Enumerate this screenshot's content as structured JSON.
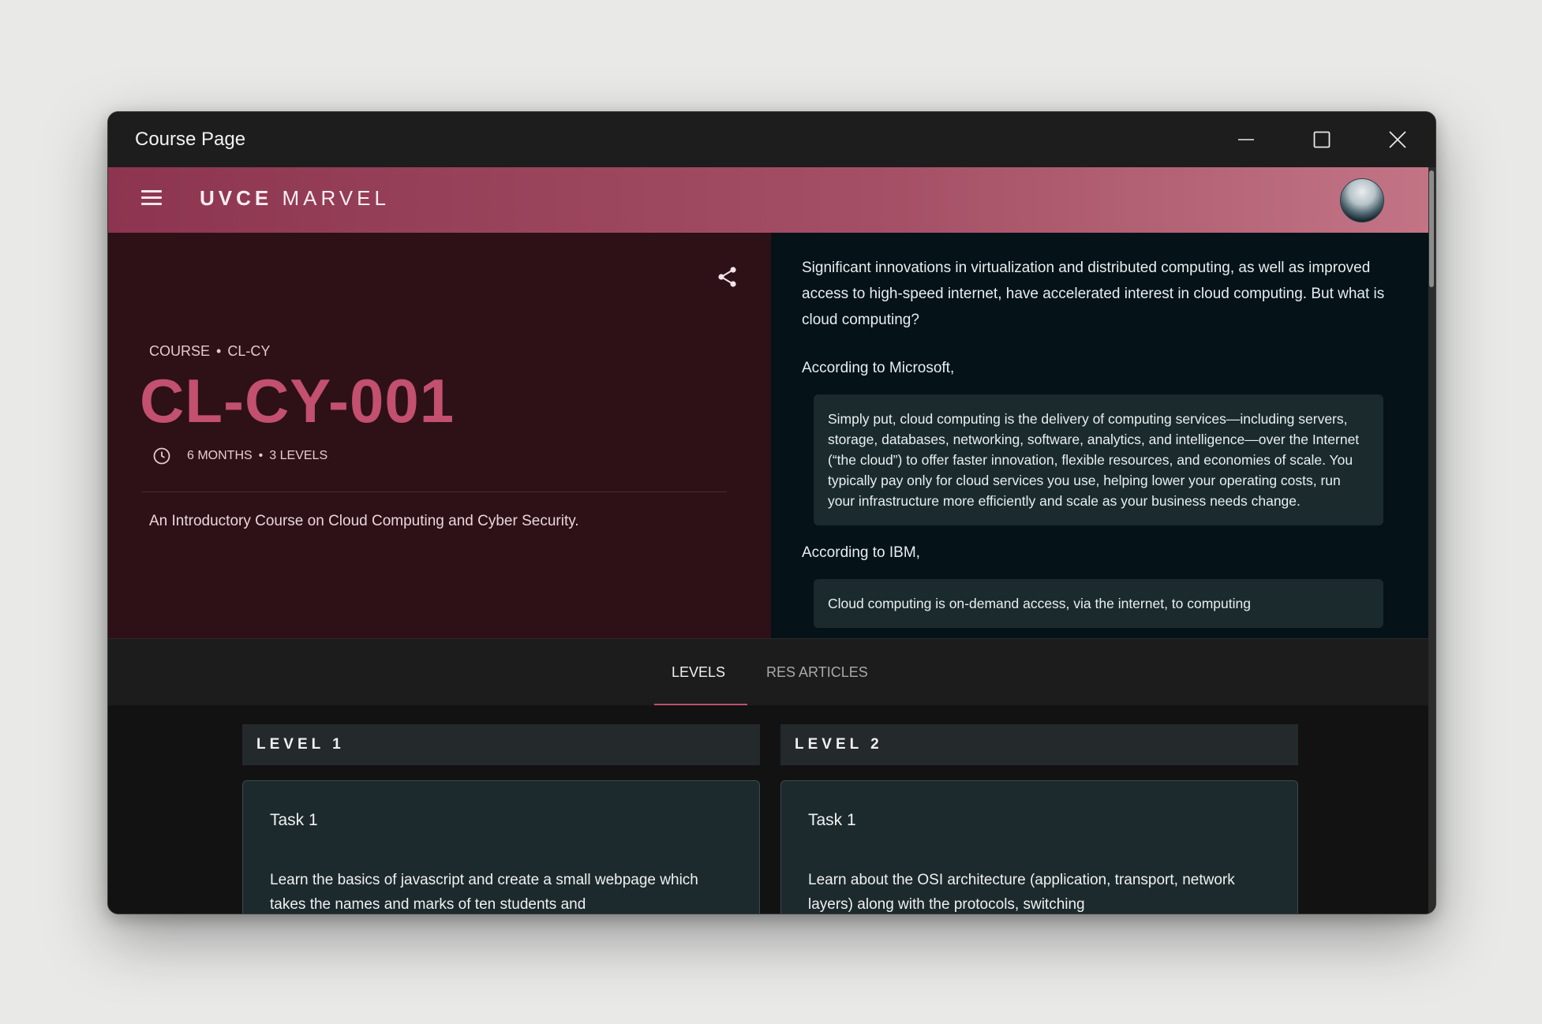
{
  "window": {
    "title": "Course Page"
  },
  "appbar": {
    "brand_bold": "UVCE",
    "brand_light": "MARVEL",
    "menu_icon": "hamburger-icon",
    "avatar_icon": "avatar"
  },
  "course": {
    "type_label": "COURSE",
    "category": "CL-CY",
    "code": "CL-CY-001",
    "duration": "6 MONTHS",
    "levels_count": "3 LEVELS",
    "description": "An Introductory Course on Cloud Computing and Cyber Security.",
    "share_icon": "share-icon",
    "clock_icon": "clock-icon"
  },
  "article": {
    "intro": "Significant innovations in virtualization and distributed computing, as well as improved access to high-speed internet, have accelerated interest in cloud computing. But what is cloud computing?",
    "according_microsoft": "According to Microsoft,",
    "quote_microsoft": "Simply put, cloud computing is the delivery of computing services—including servers, storage, databases, networking, software, analytics, and intelligence—over the Internet (“the cloud”) to offer faster innovation, flexible resources, and economies of scale. You typically pay only for cloud services you use, helping lower your operating costs, run your infrastructure more efficiently and scale as your business needs change.",
    "according_ibm": "According to IBM,",
    "quote_ibm": "Cloud computing is on-demand access, via the internet, to computing"
  },
  "tabs": [
    {
      "label": "LEVELS",
      "active": true
    },
    {
      "label": "RES ARTICLES",
      "active": false
    }
  ],
  "levels": [
    {
      "header": "LEVEL 1",
      "task_title": "Task 1",
      "task_desc": "Learn the basics of javascript and create a small webpage which takes the names and marks of ten students and"
    },
    {
      "header": "LEVEL 2",
      "task_title": "Task 1",
      "task_desc": "Learn about the OSI architecture (application, transport, network layers) along with the protocols, switching"
    }
  ],
  "colors": {
    "accent": "#c2506e",
    "appbar_start": "#8d3550",
    "appbar_end": "#c27485",
    "left_panel_bg": "#2d1117",
    "right_panel_bg": "#051218"
  }
}
